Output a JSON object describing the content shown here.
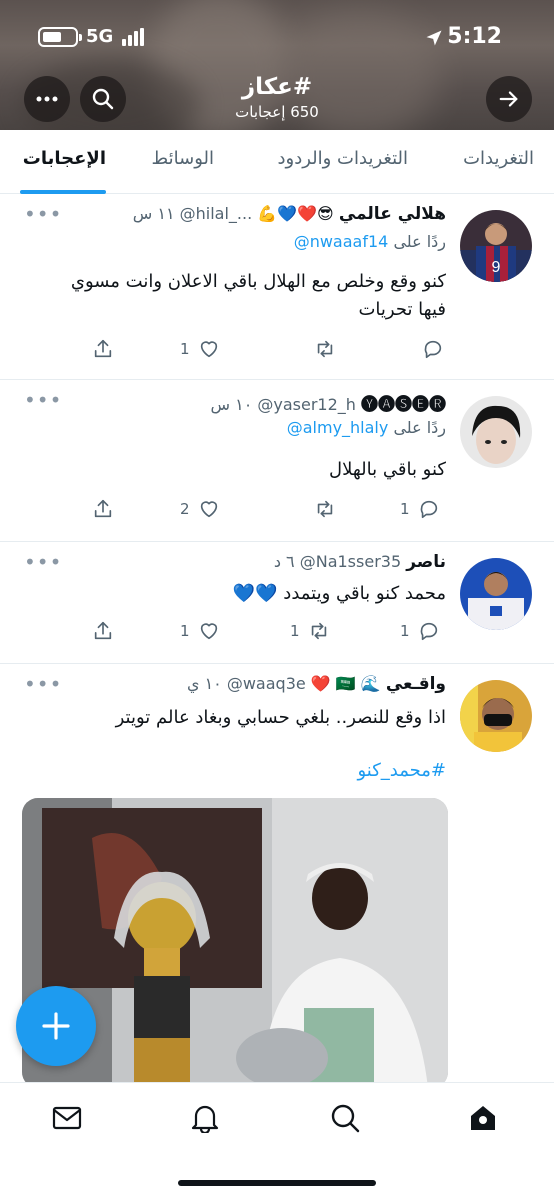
{
  "status_bar": {
    "network": "5G",
    "time": "5:12"
  },
  "header": {
    "title": "#عكاز",
    "subtitle": "650 إعجابات"
  },
  "tabs": [
    {
      "label": "التغريدات",
      "active": false
    },
    {
      "label": "التغريدات والردود",
      "active": false
    },
    {
      "label": "الوسائط",
      "active": false
    },
    {
      "label": "الإعجابات",
      "active": true
    }
  ],
  "tweets": [
    {
      "name": "هلالي عالمي",
      "emojis": "😎❤️💙💪",
      "handle": "@hilal_...",
      "time": "١١ س",
      "reply_prefix": "ردًا على",
      "reply_to": "@nwaaaf14",
      "text_lines": [
        "كنو وقع وخلص مع الهلال باقي الاعلان وانت مسوي",
        "فيها تحريات"
      ],
      "reply_count": "",
      "retweet_count": "",
      "like_count": "1"
    },
    {
      "name": "🅨🅐🅢🅔🅡",
      "emojis": "",
      "handle": "@yaser12_h",
      "time": "١٠ س",
      "reply_prefix": "ردًا على",
      "reply_to": "@almy_hlaly",
      "text_lines": [
        "كنو باقي بالهلال"
      ],
      "reply_count": "1",
      "retweet_count": "",
      "like_count": "2"
    },
    {
      "name": "ناصر",
      "emojis": "",
      "handle": "@Na1sser35",
      "time": "٦ د",
      "text_lines": [
        "محمد كنو باقي ويتمدد 💙💙"
      ],
      "reply_count": "1",
      "retweet_count": "1",
      "like_count": "1"
    },
    {
      "name": "واقـعي",
      "emojis": "🌊 🇸🇦 ❤️",
      "handle": "@waaq3e",
      "time": "١٠ ي",
      "text_lines": [
        "اذا وقع للنصر.. بلغي حسابي وبغاد عالم تويتر"
      ],
      "hashtag": "#محمد_كنو"
    }
  ],
  "more_glyph": "•••",
  "colors": {
    "accent": "#1d9bf0",
    "text": "#0f1419",
    "muted": "#536471",
    "divider": "#e6ecf0"
  }
}
